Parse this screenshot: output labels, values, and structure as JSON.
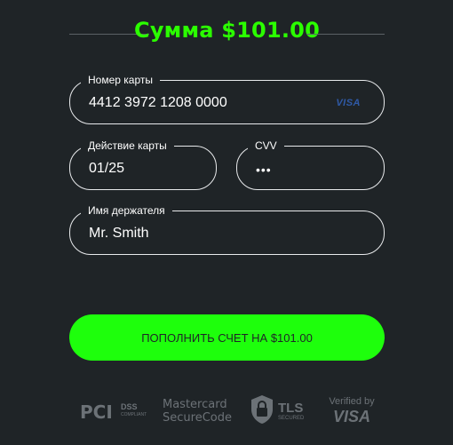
{
  "header": {
    "title": "Сумма $101.00"
  },
  "form": {
    "card_number": {
      "label": "Номер карты",
      "value": "4412 3972 1208 0000",
      "brand": "VISA"
    },
    "expiry": {
      "label": "Действие карты",
      "value": "01/25"
    },
    "cvv": {
      "label": "CVV",
      "value": "•••"
    },
    "holder": {
      "label": "Имя держателя",
      "value": "Mr. Smith"
    }
  },
  "submit": {
    "label": "ПОПОЛНИТЬ СЧЕТ НА $101.00"
  },
  "badges": {
    "pci": {
      "word": "PCI",
      "dss": "DSS",
      "sub": "COMPLIANT"
    },
    "mastercard": {
      "line1": "Mastercard",
      "line2": "SecureCode"
    },
    "tls": {
      "word": "TLS",
      "sub": "SECURED"
    },
    "visa": {
      "line1": "Verified by",
      "line2": "VISA"
    }
  },
  "colors": {
    "background": "#1f2427",
    "accent": "#1eff0c",
    "title": "#2bff00",
    "badge": "#6c7277"
  }
}
